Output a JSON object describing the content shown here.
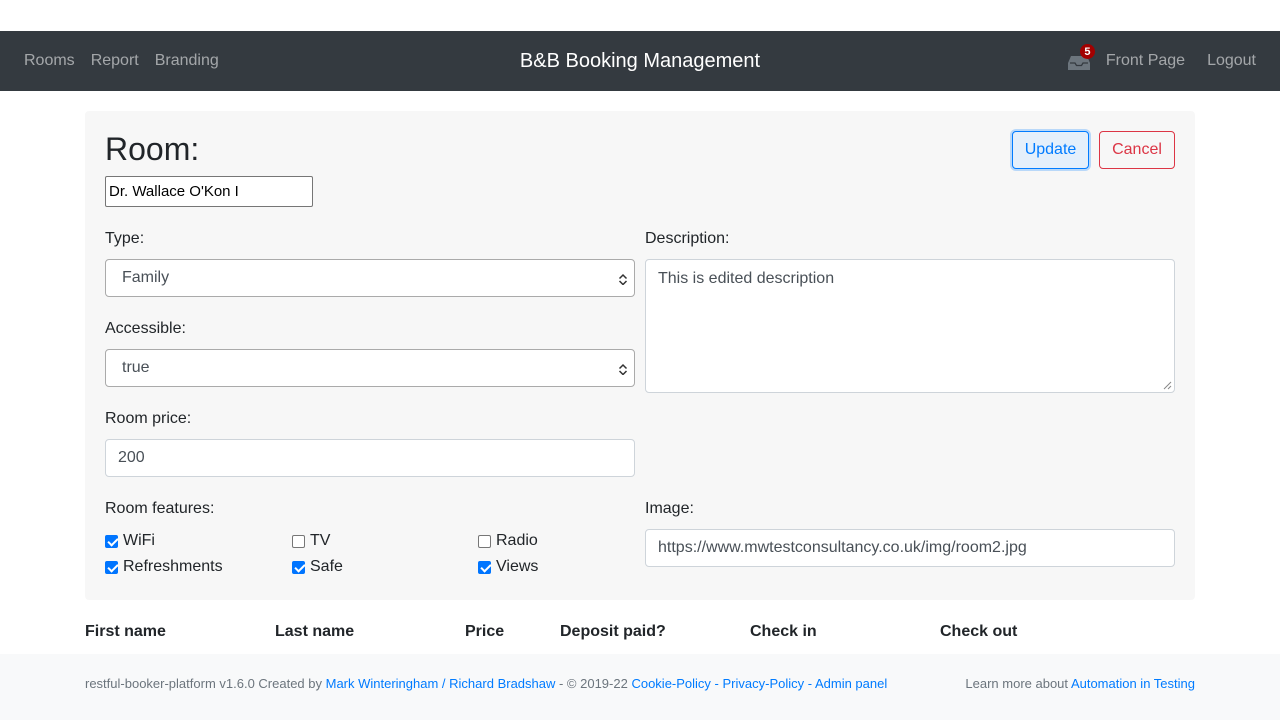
{
  "nav": {
    "links": [
      "Rooms",
      "Report",
      "Branding"
    ],
    "title": "B&B Booking Management",
    "notification_count": "5",
    "front_page": "Front Page",
    "logout": "Logout"
  },
  "form": {
    "heading": "Room:",
    "room_name": "Dr. Wallace O'Kon I",
    "update_label": "Update",
    "cancel_label": "Cancel",
    "type_label": "Type:",
    "type_value": "Family",
    "accessible_label": "Accessible:",
    "accessible_value": "true",
    "price_label": "Room price:",
    "price_value": "200",
    "description_label": "Description:",
    "description_value": "This is edited description",
    "features_label": "Room features:",
    "features": [
      {
        "label": "WiFi",
        "checked": true
      },
      {
        "label": "TV",
        "checked": false
      },
      {
        "label": "Radio",
        "checked": false
      },
      {
        "label": "Refreshments",
        "checked": true
      },
      {
        "label": "Safe",
        "checked": true
      },
      {
        "label": "Views",
        "checked": true
      }
    ],
    "image_label": "Image:",
    "image_value": "https://www.mwtestconsultancy.co.uk/img/room2.jpg"
  },
  "table": {
    "headers": [
      "First name",
      "Last name",
      "Price",
      "Deposit paid?",
      "Check in",
      "Check out"
    ]
  },
  "footer": {
    "prefix": "restful-booker-platform v1.6.0 Created by ",
    "author1": "Mark Winteringham",
    "sep1": " / ",
    "author2": "Richard Bradshaw",
    "copyright": " - © 2019-22 ",
    "cookie": "Cookie-Policy",
    "dash1": " - ",
    "privacy": "Privacy-Policy",
    "dash2": " - ",
    "admin": "Admin panel",
    "learn_prefix": "Learn more about ",
    "learn_link": "Automation in Testing"
  },
  "colors": {
    "navbar": "#343a40",
    "accent": "#007bff",
    "danger": "#dc3545",
    "badge": "#a30000"
  }
}
